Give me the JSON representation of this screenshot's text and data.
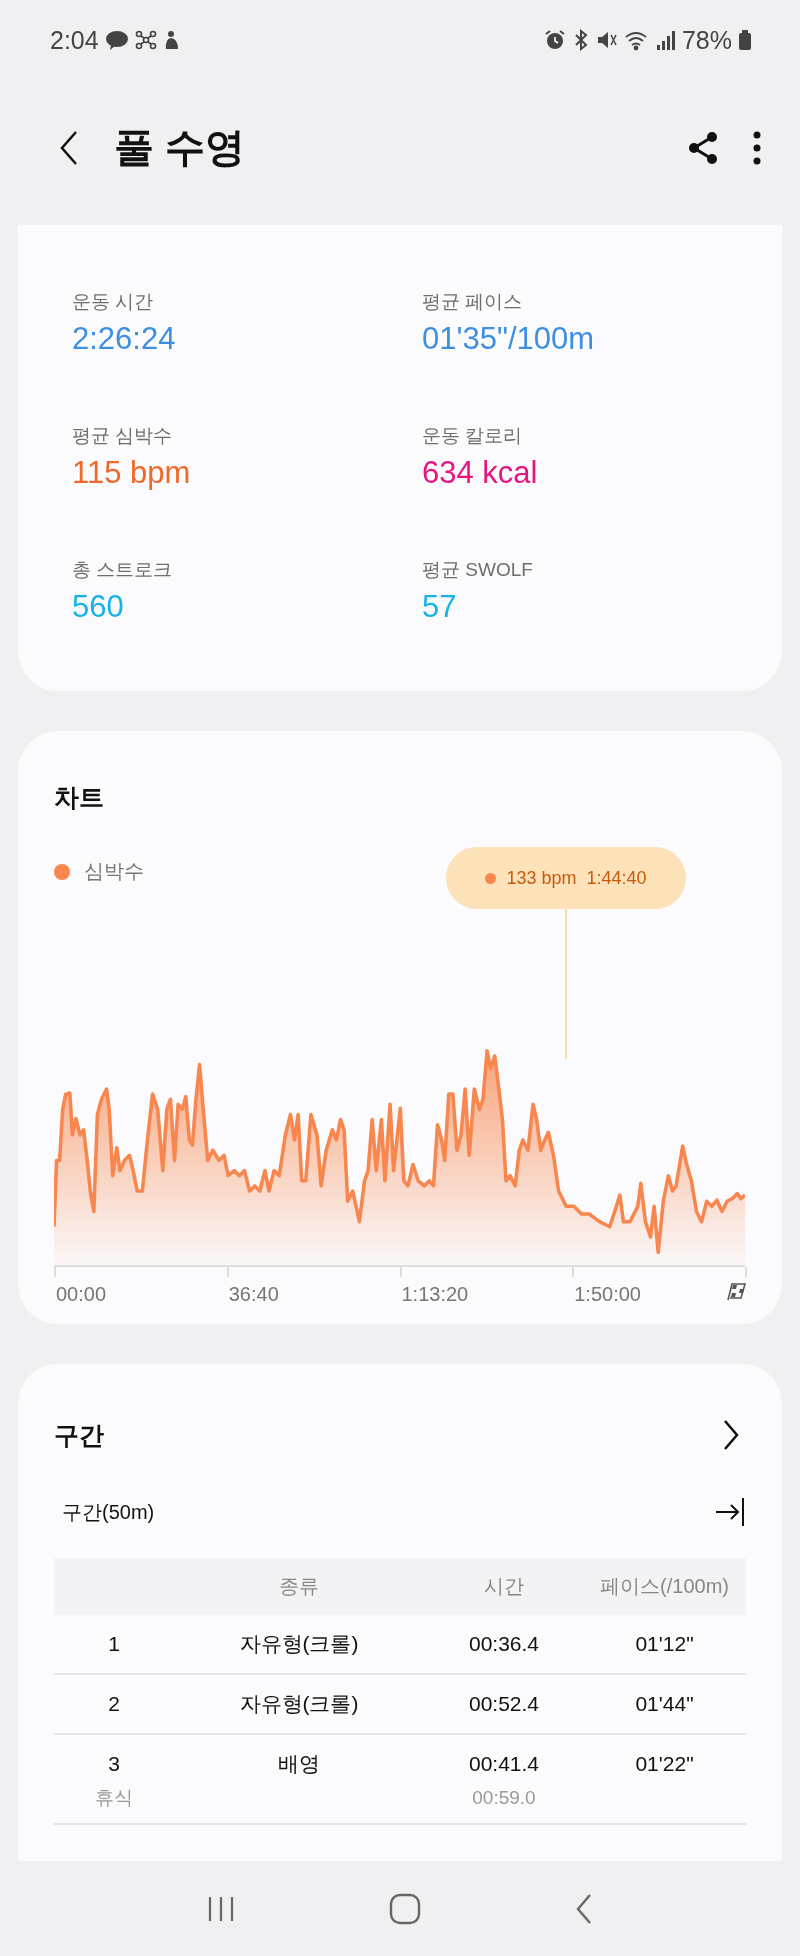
{
  "status_bar": {
    "time": "2:04",
    "battery": "78%"
  },
  "header": {
    "title": "풀 수영"
  },
  "stats": [
    {
      "label": "운동 시간",
      "value": "2:26:24",
      "color": "#3d8fe0"
    },
    {
      "label": "평균 페이스",
      "value": "01'35\"/100m",
      "color": "#3d8fe0"
    },
    {
      "label": "평균 심박수",
      "value": "115 bpm",
      "color": "#f0682a"
    },
    {
      "label": "운동 칼로리",
      "value": "634 kcal",
      "color": "#e8157e"
    },
    {
      "label": "총 스트로크",
      "value": "560",
      "color": "#19b2e8"
    },
    {
      "label": "평균 SWOLF",
      "value": "57",
      "color": "#19b2e8"
    }
  ],
  "chart": {
    "title": "차트",
    "legend": "심박수",
    "tooltip": {
      "value": "133 bpm",
      "time": "1:44:40"
    },
    "x_labels": [
      "00:00",
      "36:40",
      "1:13:20",
      "1:50:00"
    ]
  },
  "intervals": {
    "title": "구간",
    "subtitle": "구간(50m)",
    "columns": [
      "종류",
      "시간",
      "페이스(/100m)"
    ],
    "rows": [
      {
        "number": "1",
        "stroke": "자유형(크롤)",
        "time": "00:36.4",
        "pace": "01'12\""
      },
      {
        "number": "2",
        "stroke": "자유형(크롤)",
        "time": "00:52.4",
        "pace": "01'44\""
      },
      {
        "number": "3",
        "stroke": "배영",
        "time": "00:41.4",
        "pace": "01'22\"",
        "rest": {
          "label": "휴식",
          "time": "00:59.0"
        }
      }
    ]
  }
}
